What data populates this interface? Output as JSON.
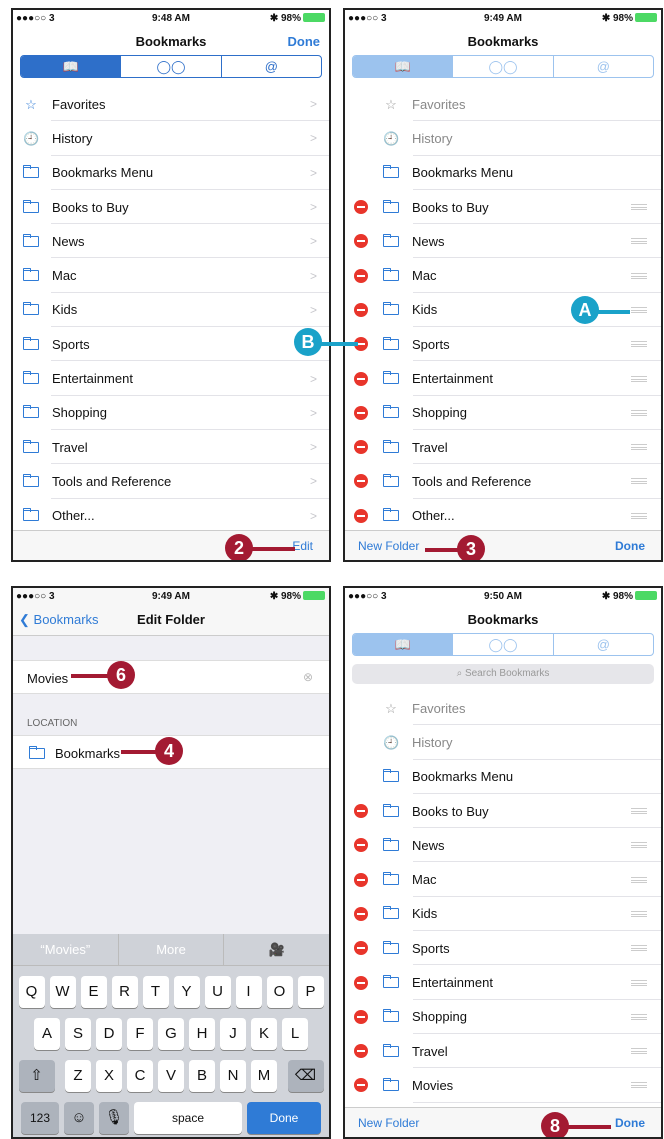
{
  "status": {
    "carrier": "●●●○○ 3",
    "battery": "98%",
    "times": [
      "9:48 AM",
      "9:49 AM",
      "9:49 AM",
      "9:50 AM"
    ]
  },
  "nav": {
    "title": "Bookmarks",
    "done": "Done",
    "edit_folder_title": "Edit Folder",
    "back": "Bookmarks"
  },
  "segments": [
    "📖",
    "◯◯",
    "@"
  ],
  "search": {
    "placeholder": "Search Bookmarks"
  },
  "items": [
    "Favorites",
    "History",
    "Bookmarks Menu",
    "Books to Buy",
    "News",
    "Mac",
    "Kids",
    "Sports",
    "Entertainment",
    "Shopping",
    "Travel",
    "Tools and Reference",
    "Other..."
  ],
  "items_final": [
    "Favorites",
    "History",
    "Bookmarks Menu",
    "Books to Buy",
    "News",
    "Mac",
    "Kids",
    "Sports",
    "Entertainment",
    "Shopping",
    "Travel",
    "Movies"
  ],
  "toolbar": {
    "edit": "Edit",
    "new_folder": "New Folder",
    "done": "Done"
  },
  "edit_folder": {
    "name": "Movies",
    "location_label": "LOCATION",
    "location": "Bookmarks"
  },
  "keyboard": {
    "suggestions": [
      "“Movies”",
      "More",
      "🎥"
    ],
    "row1": [
      "Q",
      "W",
      "E",
      "R",
      "T",
      "Y",
      "U",
      "I",
      "O",
      "P"
    ],
    "row2": [
      "A",
      "S",
      "D",
      "F",
      "G",
      "H",
      "J",
      "K",
      "L"
    ],
    "row3": [
      "Z",
      "X",
      "C",
      "V",
      "B",
      "N",
      "M"
    ],
    "num": "123",
    "space": "space",
    "done": "Done"
  },
  "markers": {
    "m2": "2",
    "m3": "3",
    "m4": "4",
    "m6": "6",
    "m8": "8",
    "a": "A",
    "b": "B"
  }
}
